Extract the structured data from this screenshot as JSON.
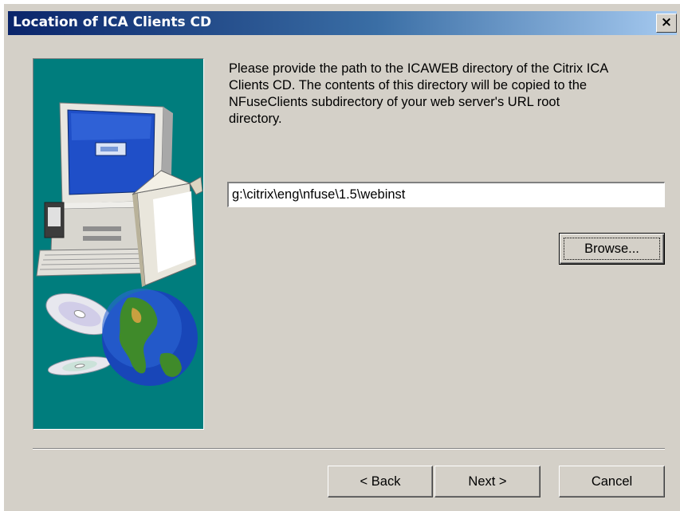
{
  "window": {
    "title": "Location of ICA Clients CD",
    "close_glyph": "✕",
    "close_icon": "close-icon"
  },
  "main": {
    "instructions": "Please provide the path to the ICAWEB directory of the Citrix ICA\nClients CD.  The contents of this directory will be copied to the\nNFuseClients subdirectory of your web server's URL root\ndirectory.",
    "path_value": "g:\\citrix\\eng\\nfuse\\1.5\\webinst",
    "browse_label": "Browse..."
  },
  "footer": {
    "back_label": "< Back",
    "next_label": "Next >",
    "cancel_label": "Cancel"
  },
  "colors": {
    "title_gradient_start": "#0a246a",
    "title_gradient_end": "#a6caf0",
    "dialog_face": "#d4d0c8",
    "side_panel": "#007d7d"
  },
  "icons": [
    "computer-illustration",
    "cd-disc-icon",
    "globe-icon"
  ]
}
